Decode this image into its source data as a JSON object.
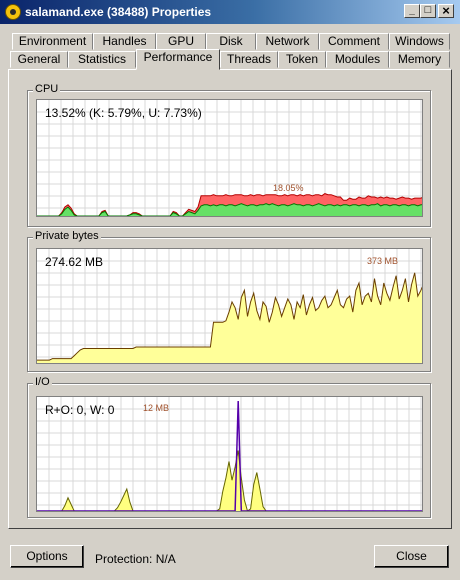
{
  "window": {
    "title": "salamand.exe (38488) Properties",
    "controls": {
      "minimize": "_",
      "maximize": "□",
      "close": "×"
    }
  },
  "tabs": {
    "row1": [
      "Environment",
      "Handles",
      "GPU",
      "Disk",
      "Network",
      "Comment",
      "Windows"
    ],
    "row2": [
      "General",
      "Statistics",
      "Performance",
      "Threads",
      "Token",
      "Modules",
      "Memory"
    ],
    "active": "Performance"
  },
  "cpu": {
    "label": "CPU",
    "readout": "13.52% (K: 5.79%, U: 7.73%)",
    "peak_label": "18.05%",
    "colors": {
      "kernel": "#ff6464",
      "user": "#66e066",
      "kernel_line": "#b40000",
      "user_line": "#007700"
    }
  },
  "private_bytes": {
    "label": "Private bytes",
    "readout": "274.62 MB",
    "peak_label": "373 MB",
    "colors": {
      "fill": "#ffff99",
      "line": "#6b3f00"
    }
  },
  "io": {
    "label": "I/O",
    "readout": "R+O: 0, W: 0",
    "peak_label": "12 MB",
    "colors": {
      "fill": "#ffff80",
      "line": "#666600",
      "write": "#5500aa"
    }
  },
  "footer": {
    "options_label": "Options",
    "protection_text": "Protection: N/A",
    "close_label": "Close"
  },
  "chart_data": [
    {
      "type": "area",
      "title": "CPU",
      "ylim": [
        0,
        100
      ],
      "series": [
        {
          "values": [
            0,
            0,
            0,
            0,
            0,
            0,
            0,
            0,
            2,
            6,
            8,
            5,
            1,
            0,
            0,
            0,
            0,
            0,
            0,
            0,
            0,
            3,
            4,
            0,
            0,
            0,
            0,
            0,
            0,
            0,
            1,
            2,
            2,
            1,
            0,
            0,
            0,
            0,
            0,
            0,
            0,
            0,
            0,
            0,
            3,
            2,
            0,
            0,
            2,
            4,
            3,
            2,
            5,
            9,
            10,
            10,
            9,
            10,
            9,
            10,
            10,
            9,
            10,
            10,
            9,
            10,
            11,
            10,
            9,
            10,
            10,
            9,
            10,
            10,
            11,
            10,
            11,
            10,
            9,
            10,
            10,
            9,
            10,
            11,
            10,
            10,
            9,
            10,
            10,
            9,
            10,
            11,
            10,
            9,
            10,
            10,
            9,
            10,
            9,
            10,
            10,
            9,
            10,
            10,
            9,
            10,
            10,
            9,
            10,
            10,
            11,
            9,
            10,
            10,
            9,
            10,
            10,
            9,
            10,
            10,
            9,
            10,
            10,
            9,
            10,
            10
          ]
        },
        {
          "values": [
            0,
            0,
            0,
            0,
            0,
            0,
            0,
            0,
            3,
            8,
            10,
            7,
            2,
            0,
            0,
            0,
            0,
            0,
            0,
            0,
            0,
            4,
            5,
            0,
            0,
            0,
            0,
            0,
            0,
            0,
            1,
            3,
            3,
            2,
            0,
            0,
            0,
            0,
            0,
            0,
            0,
            0,
            0,
            0,
            4,
            3,
            0,
            0,
            3,
            6,
            5,
            4,
            8,
            18,
            18,
            18,
            18,
            19,
            18,
            18,
            18,
            19,
            18,
            18,
            19,
            19,
            19,
            18,
            18,
            19,
            18,
            19,
            19,
            18,
            19,
            19,
            19,
            19,
            18,
            18,
            19,
            18,
            19,
            19,
            18,
            19,
            18,
            19,
            19,
            18,
            19,
            19,
            18,
            20,
            19,
            19,
            18,
            17,
            17,
            14,
            14,
            16,
            15,
            15,
            17,
            16,
            16,
            18,
            17,
            17,
            16,
            17,
            16,
            17,
            16,
            16,
            15,
            16,
            17,
            16,
            16,
            15,
            16,
            16,
            16,
            17
          ]
        }
      ]
    },
    {
      "type": "area",
      "title": "Private bytes",
      "series": [
        {
          "values": [
            2,
            2,
            2,
            2,
            2,
            3,
            3,
            3,
            3,
            3,
            3,
            3,
            5,
            7,
            9,
            10,
            10,
            10,
            10,
            10,
            10,
            10,
            10,
            10,
            10,
            10,
            10,
            10,
            10,
            10,
            10,
            10,
            11,
            11,
            11,
            11,
            11,
            11,
            11,
            11,
            11,
            11,
            11,
            11,
            11,
            11,
            11,
            11,
            11,
            11,
            11,
            11,
            11,
            11,
            11,
            11,
            11,
            28,
            28,
            28,
            28,
            29,
            35,
            42,
            38,
            30,
            45,
            50,
            32,
            42,
            48,
            36,
            30,
            42,
            39,
            28,
            35,
            45,
            40,
            32,
            38,
            44,
            40,
            30,
            42,
            38,
            47,
            33,
            40,
            45,
            36,
            38,
            43,
            46,
            38,
            40,
            45,
            50,
            40,
            38,
            44,
            46,
            35,
            50,
            55,
            40,
            46,
            48,
            42,
            58,
            46,
            40,
            55,
            48,
            43,
            52,
            60,
            44,
            50,
            58,
            42,
            54,
            62,
            46,
            50,
            55
          ]
        }
      ]
    },
    {
      "type": "area",
      "title": "I/O",
      "series": [
        {
          "values": [
            0,
            0,
            0,
            0,
            0,
            0,
            0,
            0,
            0,
            5,
            12,
            6,
            0,
            0,
            0,
            0,
            0,
            0,
            0,
            0,
            0,
            0,
            0,
            0,
            0,
            0,
            3,
            8,
            14,
            20,
            8,
            0,
            0,
            0,
            0,
            0,
            0,
            0,
            0,
            0,
            0,
            0,
            0,
            0,
            0,
            0,
            0,
            0,
            0,
            0,
            0,
            0,
            0,
            0,
            0,
            0,
            0,
            0,
            0,
            2,
            18,
            30,
            45,
            28,
            40,
            55,
            30,
            10,
            0,
            2,
            24,
            35,
            20,
            4,
            0,
            0,
            0,
            0,
            0,
            0,
            0,
            0,
            0,
            0,
            0,
            0,
            0,
            0,
            0,
            0,
            0,
            0,
            0,
            0,
            0,
            0,
            0,
            0,
            0,
            0,
            0,
            0,
            0,
            0,
            0,
            0,
            0,
            0,
            0,
            0,
            0,
            0,
            0,
            0,
            0,
            0,
            0,
            0,
            0,
            0,
            0,
            0,
            0,
            0,
            0,
            0
          ]
        },
        {
          "values": [
            0,
            0,
            0,
            0,
            0,
            0,
            0,
            0,
            0,
            0,
            0,
            0,
            0,
            0,
            0,
            0,
            0,
            0,
            0,
            0,
            0,
            0,
            0,
            0,
            0,
            0,
            0,
            0,
            0,
            0,
            0,
            0,
            0,
            0,
            0,
            0,
            0,
            0,
            0,
            0,
            0,
            0,
            0,
            0,
            0,
            0,
            0,
            0,
            0,
            0,
            0,
            0,
            0,
            0,
            0,
            0,
            0,
            0,
            0,
            0,
            0,
            0,
            0,
            0,
            0,
            100,
            0,
            0,
            0,
            0,
            0,
            0,
            0,
            0,
            0,
            0,
            0,
            0,
            0,
            0,
            0,
            0,
            0,
            0,
            0,
            0,
            0,
            0,
            0,
            0,
            0,
            0,
            0,
            0,
            0,
            0,
            0,
            0,
            0,
            0,
            0,
            0,
            0,
            0,
            0,
            0,
            0,
            0,
            0,
            0,
            0,
            0,
            0,
            0,
            0,
            0,
            0,
            0,
            0,
            0,
            0,
            0,
            0,
            0,
            0,
            0
          ]
        }
      ]
    }
  ]
}
